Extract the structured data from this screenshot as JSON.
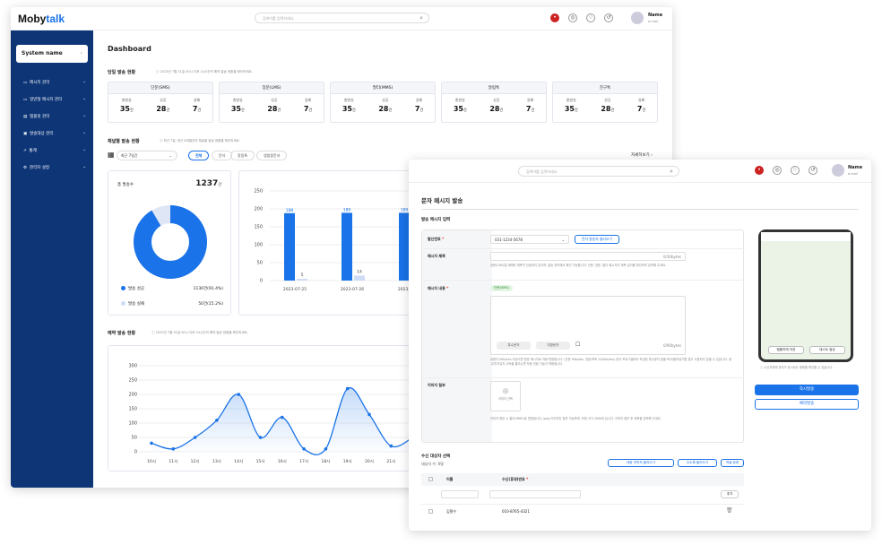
{
  "dashboard": {
    "logo_a": "Moby",
    "logo_b": "talk",
    "search_placeholder": "검색어를 입력하세요.",
    "user": {
      "name": "Name",
      "email": "e-mail"
    },
    "system_name": "System name",
    "menu": [
      "메시지 관리",
      "일반형 메시지 관리",
      "템플릿 관리",
      "발송대상 관리",
      "통계",
      "관리자 설정"
    ],
    "title": "Dashboard",
    "today": {
      "title": "당일 발송 현황",
      "note": "2023년 7월 31일 00시 이후 24시간의 예약 발송 현황을 확인하세요.",
      "cards": [
        {
          "name": "단문(SMS)",
          "total": "35",
          "success": "28",
          "fail": "7"
        },
        {
          "name": "장문(LMS)",
          "total": "35",
          "success": "28",
          "fail": "7"
        },
        {
          "name": "멀티(MMS)",
          "total": "35",
          "success": "28",
          "fail": "7"
        },
        {
          "name": "알림톡",
          "total": "35",
          "success": "28",
          "fail": "7"
        },
        {
          "name": "친구톡",
          "total": "35",
          "success": "28",
          "fail": "7"
        }
      ],
      "labels": {
        "total": "총발송",
        "success": "성공",
        "fail": "실패",
        "unit": "건"
      }
    },
    "channel": {
      "title": "채널별 발송 현황",
      "note": "최근 7일, 최근 6개월간의 채널별 발송 현황을 확인하세요.",
      "period": "최근 7일간",
      "chips": [
        "전체",
        "문자",
        "알림톡",
        "앱범용문자"
      ],
      "more": "자세히보기",
      "total_label": "총 발송수",
      "total_value": "1237",
      "unit": "건",
      "success_label": "발송 성공",
      "success_value": "1130건(91.4%)",
      "fail_label": "발송 실패",
      "fail_value": "50건(15.2%)"
    },
    "reserve": {
      "title": "예약 발송 현황",
      "note": "2023년 7월 31일 00시 이후 24시간의 예약 발송 현황을 확인하세요."
    }
  },
  "sms": {
    "search_placeholder": "검색어를 입력하세요.",
    "user": {
      "name": "Name",
      "email": "e-mail"
    },
    "title": "문자 메시지 발송",
    "section": "발송 메시지 입력",
    "sender_label": "발신번호",
    "sender_value": "031-1234-5678",
    "sender_btn": "문자 발송자 불러오기",
    "subject_label": "메시지 제목",
    "subject_count": "0/30bytes",
    "subject_help": "장문(LMS)일 때에만 제목이 전송되지 않으며, 발송 관리에서 확인 가능합니다. 단문, 장문, 멀티 메시지의 제목 길이를 확인하여 입력해 주세요.",
    "content_label": "메시지 내용",
    "content_tag": "단문(SMS)",
    "content_btn1": "특수문자",
    "content_btn2": "치환문자",
    "content_count": "0/90bytes",
    "content_help": "내용이 90bytes 이상이면 장문 메시지로 자동 변환됩니다. (단문 90bytes, 장문/포토 2000bytes) 문서 프로그램에서 작성한 특수문자 등을 복사/붙여넣기할 경우 사용되지 않을 수 있습니다. 광고/투자유치 수탁을 올리시면 자동 전환 기능이 적용됩니다.",
    "image_label": "이미지 첨부",
    "image_btn": "이미지 선택",
    "image_help": "이미지 첨부 시 멀티(MMS)로 변환됩니다. jpeg 이미지만 첨부 가능하며, 최대 크기 300KB 입니다. 이미지 첨부 후 제목을 입력해 주세요.",
    "phone_btn1": "템플릿에 저장",
    "phone_btn2": "테스트 발송",
    "phone_note": "수신자에게 문자가 표시되는 형태를 확인할 수 있습니다.",
    "send_now": "즉시발송",
    "send_reserve": "예약발송",
    "recipients_title": "수신 대상자 선택",
    "recipients_count": "대상자 수: 0명",
    "rbtn1": "대량 연락처 불러오기",
    "rbtn2": "주소록 불러오기",
    "rbtn3": "엑셀 등록",
    "col_name": "이름",
    "col_phone": "수신(휴대)번호",
    "add_btn": "추가",
    "row": {
      "name": "김철수",
      "phone": "010-8765-4321"
    }
  },
  "chart_bar": {
    "type": "bar",
    "categories": [
      "2023-07-25",
      "2023-07-26",
      "2023-07-27"
    ],
    "series": [
      {
        "values": [
          188,
          189,
          189
        ]
      },
      {
        "values": [
          5,
          14,
          3
        ]
      }
    ],
    "ylim": [
      0,
      250
    ],
    "yticks": [
      0,
      50,
      100,
      150,
      200,
      250
    ]
  },
  "chart_line": {
    "type": "area",
    "categories": [
      "10시",
      "11시",
      "12시",
      "13시",
      "14시",
      "15시",
      "16시",
      "17시",
      "18시",
      "19시",
      "20시",
      "21시",
      "22시"
    ],
    "values": [
      30,
      10,
      50,
      110,
      200,
      50,
      120,
      10,
      10,
      220,
      130,
      20,
      50
    ],
    "ylim": [
      0,
      300
    ],
    "yticks": [
      0,
      50,
      100,
      150,
      200,
      250,
      300
    ]
  },
  "colors": {
    "primary": "#1a73e8",
    "sidebar": "#0e3677",
    "light": "#cfdcf6"
  }
}
